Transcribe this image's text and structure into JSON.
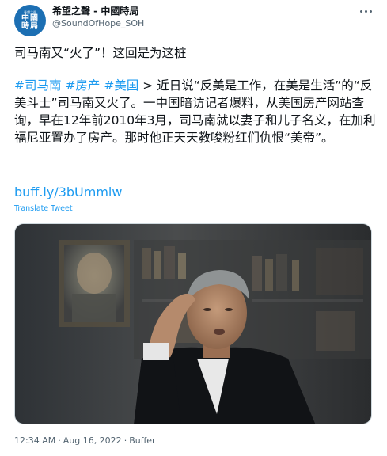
{
  "account": {
    "avatar_small_text": "希望之聲",
    "avatar_line1": "中國",
    "avatar_line2": "時局",
    "display_name": "希望之聲 - 中國時局",
    "handle": "@SoundOfHope_SOH"
  },
  "tweet": {
    "headline": "司马南又“火了”！这回是为这桩",
    "hashtags": [
      "#司马南",
      "#房产",
      "#美国"
    ],
    "body_text": " > 近日说“反美是工作，在美是生活”的“反美斗士”司马南又火了。一中国暗访记者爆料，从美国房产网站查询，早在12年前2010年3月，司马南就以妻子和儿子名义，在加利福尼亚置办了房产。那时他正天天教唆粉红们仇恨“美帝”。",
    "link": "buff.ly/3bUmmlw",
    "translate_label": "Translate Tweet"
  },
  "meta": {
    "time": "12:34 AM",
    "separator": "·",
    "date": "Aug 16, 2022",
    "source": "Buffer"
  },
  "icons": {
    "more": "more-horizontal-icon"
  },
  "colors": {
    "link": "#1d9bf0",
    "text": "#0f1419",
    "secondary": "#536471",
    "avatar_bg": "#1c6fb3"
  }
}
